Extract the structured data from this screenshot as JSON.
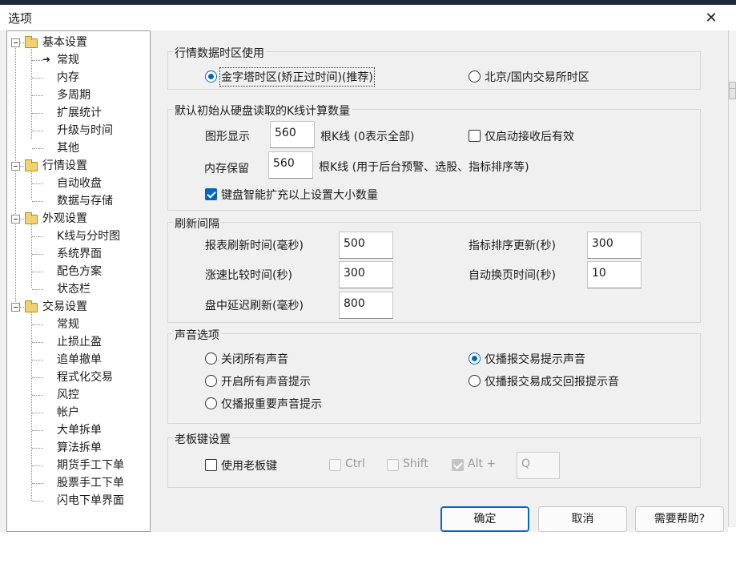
{
  "window": {
    "title": "选项",
    "close_icon": "close-icon"
  },
  "tree": {
    "groups": [
      {
        "label": "基本设置",
        "items": [
          "常规",
          "内存",
          "多周期",
          "扩展统计",
          "升级与时间",
          "其他"
        ],
        "selected_index": 0
      },
      {
        "label": "行情设置",
        "items": [
          "自动收盘",
          "数据与存储"
        ]
      },
      {
        "label": "外观设置",
        "items": [
          "K线与分时图",
          "系统界面",
          "配色方案",
          "状态栏"
        ]
      },
      {
        "label": "交易设置",
        "items": [
          "常规",
          "止损止盈",
          "追单撤单",
          "程式化交易",
          "风控",
          "帐户",
          "大单拆单",
          "算法拆单",
          "期货手工下单",
          "股票手工下单",
          "闪电下单界面"
        ]
      }
    ]
  },
  "timezone": {
    "title": "行情数据时区使用",
    "option_a": "金字塔时区(矫正过时间)(推荐)",
    "option_b": "北京/国内交易所时区",
    "selected": "a"
  },
  "kline": {
    "title": "默认初始从硬盘读取的K线计算数量",
    "display_label": "图形显示",
    "display_value": "560",
    "display_suffix": "根K线 (0表示全部)",
    "startup_only_label": "仅启动接收后有效",
    "startup_only_checked": false,
    "memory_label": "内存保留",
    "memory_value": "560",
    "memory_suffix": "根K线  (用于后台预警、选股、指标排序等)",
    "auto_expand_label": "键盘智能扩充以上设置大小数量",
    "auto_expand_checked": true
  },
  "refresh": {
    "title": "刷新间隔",
    "report_label": "报表刷新时间(毫秒)",
    "report_value": "500",
    "indicator_label": "指标排序更新(秒)",
    "indicator_value": "300",
    "speed_label": "涨速比较时间(秒)",
    "speed_value": "300",
    "autopage_label": "自动换页时间(秒)",
    "autopage_value": "10",
    "delay_label": "盘中延迟刷新(毫秒)",
    "delay_value": "800"
  },
  "sound": {
    "title": "声音选项",
    "off_all": "关闭所有声音",
    "on_all": "开启所有声音提示",
    "important_only": "仅播报重要声音提示",
    "trade_only": "仅播报交易提示声音",
    "trade_fill": "仅播报交易成交回报提示音",
    "selected": "trade_only"
  },
  "boss_key": {
    "title": "老板键设置",
    "use_label": "使用老板键",
    "use_checked": false,
    "ctrl_label": "Ctrl",
    "shift_label": "Shift",
    "alt_label": "Alt +",
    "key_value": "Q"
  },
  "buttons": {
    "ok": "确定",
    "cancel": "取消",
    "help": "需要帮助?"
  }
}
